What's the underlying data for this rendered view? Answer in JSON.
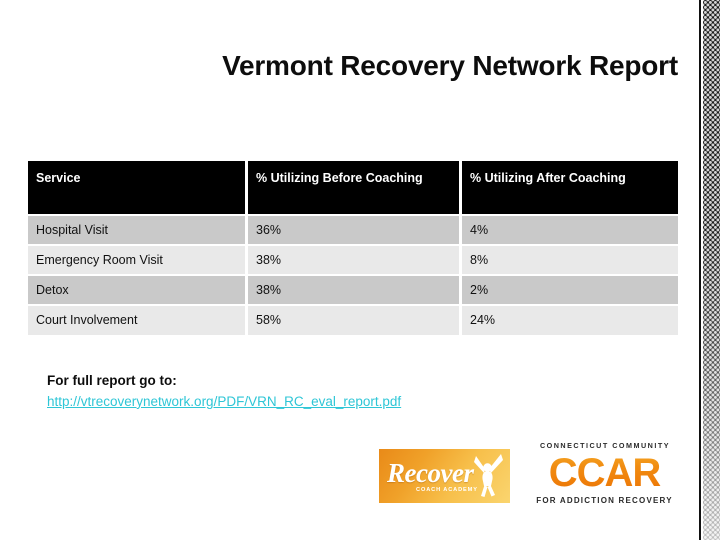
{
  "slide": {
    "title": "Vermont Recovery Network Report"
  },
  "table": {
    "headers": [
      "Service",
      "% Utilizing Before Coaching",
      "% Utilizing After Coaching"
    ],
    "rows": [
      {
        "service": "Hospital Visit",
        "before": "36%",
        "after": "4%"
      },
      {
        "service": "Emergency Room Visit",
        "before": "38%",
        "after": "8%"
      },
      {
        "service": "Detox",
        "before": "38%",
        "after": "2%"
      },
      {
        "service": "Court Involvement",
        "before": "58%",
        "after": "24%"
      }
    ]
  },
  "note": {
    "line1": "For full report go to:",
    "link": "http://vtrecoverynetwork.org/PDF/VRN_RC_eval_report.pdf"
  },
  "logos": {
    "recover": {
      "word": "Recover",
      "sub": "COACH ACADEMY"
    },
    "ccar": {
      "top": "CONNECTICUT COMMUNITY",
      "main": "CCAR",
      "bottom": "FOR ADDICTION RECOVERY"
    }
  },
  "colors": {
    "header_bg": "#000000",
    "row_odd": "#c9c9c9",
    "row_even": "#e9e9e9",
    "link": "#2ec6d6",
    "logo_orange": "#ef7f0a"
  }
}
